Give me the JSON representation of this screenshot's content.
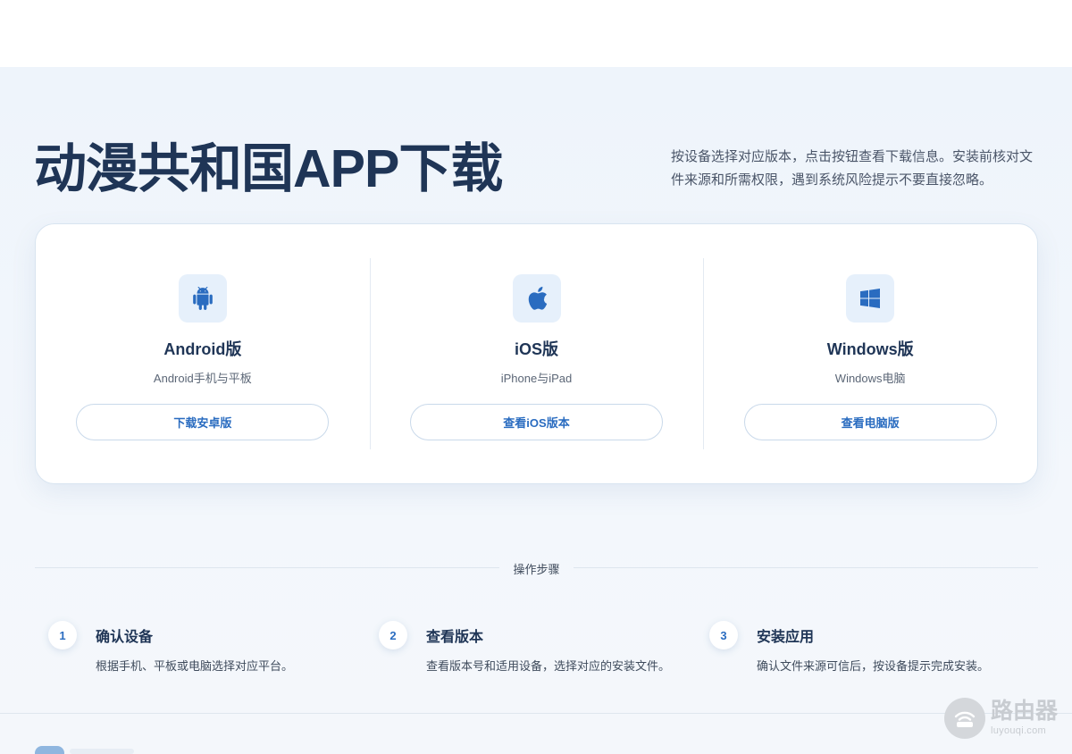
{
  "hero": {
    "title": "动漫共和国APP下载",
    "description": "按设备选择对应版本，点击按钮查看下载信息。安装前核对文件来源和所需权限，遇到系统风险提示不要直接忽略。"
  },
  "platforms": [
    {
      "name": "Android版",
      "sub": "Android手机与平板",
      "button": "下载安卓版",
      "icon": "android-icon"
    },
    {
      "name": "iOS版",
      "sub": "iPhone与iPad",
      "button": "查看iOS版本",
      "icon": "apple-icon"
    },
    {
      "name": "Windows版",
      "sub": "Windows电脑",
      "button": "查看电脑版",
      "icon": "windows-icon"
    }
  ],
  "steps_section": {
    "label": "操作步骤",
    "steps": [
      {
        "num": "1",
        "title": "确认设备",
        "text": "根据手机、平板或电脑选择对应平台。"
      },
      {
        "num": "2",
        "title": "查看版本",
        "text": "查看版本号和适用设备，选择对应的安装文件。"
      },
      {
        "num": "3",
        "title": "安装应用",
        "text": "确认文件来源可信后，按设备提示完成安装。"
      }
    ]
  },
  "watermark": {
    "main": "路由器",
    "sub": "luyouqi.com"
  },
  "colors": {
    "accent": "#2a6cc0",
    "title": "#1f3556",
    "icon_bg": "#e6f0fb"
  }
}
